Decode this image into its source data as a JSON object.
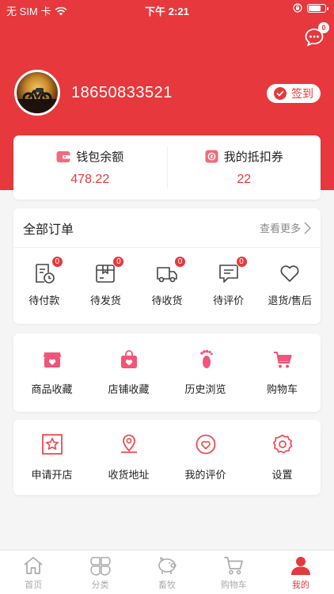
{
  "status": {
    "carrier": "无 SIM 卡",
    "time": "下午 2:21",
    "battery_level": 0.8
  },
  "header": {
    "message_badge": "0"
  },
  "user": {
    "phone": "18650833521",
    "signin_label": "签到"
  },
  "wallet": {
    "balance_label": "钱包余额",
    "balance_value": "478.22",
    "coupon_label": "我的抵扣券",
    "coupon_value": "22"
  },
  "orders": {
    "title": "全部订单",
    "more": "查看更多",
    "items": [
      {
        "label": "待付款",
        "badge": "0"
      },
      {
        "label": "待发货",
        "badge": "0"
      },
      {
        "label": "待收货",
        "badge": "0"
      },
      {
        "label": "待评价",
        "badge": "0"
      },
      {
        "label": "退货/售后"
      }
    ]
  },
  "favorites": {
    "items": [
      {
        "label": "商品收藏"
      },
      {
        "label": "店铺收藏"
      },
      {
        "label": "历史浏览"
      },
      {
        "label": "购物车"
      }
    ]
  },
  "services": {
    "items": [
      {
        "label": "申请开店"
      },
      {
        "label": "收货地址"
      },
      {
        "label": "我的评价"
      },
      {
        "label": "设置"
      }
    ]
  },
  "tabbar": {
    "items": [
      {
        "label": "首页"
      },
      {
        "label": "分类"
      },
      {
        "label": "畜牧"
      },
      {
        "label": "购物车"
      },
      {
        "label": "我的"
      }
    ]
  },
  "colors": {
    "accent": "#e6383d",
    "background": "#f5f5f5"
  }
}
